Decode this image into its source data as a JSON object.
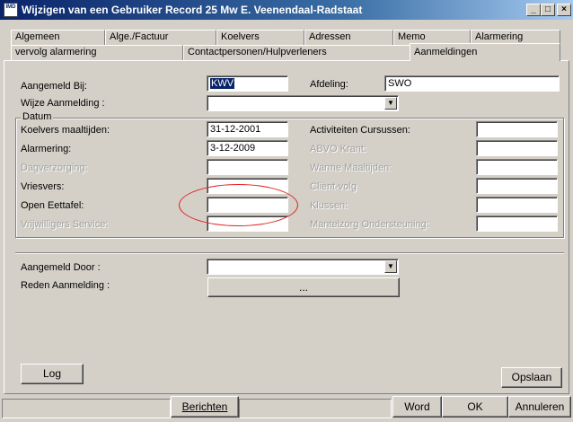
{
  "window": {
    "title": "Wijzigen van een Gebruiker Record 25 Mw E. Veenendaal-Radstaat",
    "icon_text": "IMD",
    "minimize_symbol": "_",
    "maximize_symbol": "□",
    "close_symbol": "×"
  },
  "tabs_row1": [
    "Algemeen",
    "Alge./Factuur",
    "Koelvers",
    "Adressen",
    "Memo",
    "Alarmering"
  ],
  "tabs_row2": [
    "vervolg alarmering",
    "Contactpersonen/Hulpverleners",
    "Aanmeldingen"
  ],
  "active_tab": "Aanmeldingen",
  "form": {
    "aangemeld_bij_label": "Aangemeld Bij:",
    "aangemeld_bij_value": "KWV",
    "afdeling_label": "Afdeling:",
    "afdeling_value": "SWO",
    "wijze_label": "Wijze Aanmelding :",
    "wijze_value": "",
    "datum_group_label": "Datum",
    "rows_left": [
      {
        "label": "Koelvers maaltijden:",
        "value": "31-12-2001",
        "disabled": false
      },
      {
        "label": "Alarmering:",
        "value": "3-12-2009",
        "disabled": false
      },
      {
        "label": "Dagverzorging:",
        "value": "",
        "disabled": true
      },
      {
        "label": "Vriesvers:",
        "value": "",
        "disabled": false
      },
      {
        "label": "Open Eettafel:",
        "value": "",
        "disabled": false
      },
      {
        "label": "Vrijwilligers Service:",
        "value": "",
        "disabled": true
      }
    ],
    "rows_right": [
      {
        "label": "Activiteiten Cursussen:",
        "value": "",
        "disabled": false
      },
      {
        "label": "ABVO Krant:",
        "value": "",
        "disabled": true
      },
      {
        "label": "Warme Maaltijden:",
        "value": "",
        "disabled": true
      },
      {
        "label": "Client-volg",
        "value": "",
        "disabled": true
      },
      {
        "label": "Klussen:",
        "value": "",
        "disabled": true
      },
      {
        "label": "Mantelzorg Ondersteuning:",
        "value": "",
        "disabled": true
      }
    ],
    "aangemeld_door_label": "Aangemeld Door :",
    "aangemeld_door_value": "",
    "reden_label": "Reden Aanmelding :",
    "reden_button": "...",
    "combo_arrow": "▼"
  },
  "buttons": {
    "log": "Log",
    "opslaan": "Opslaan",
    "berichten": "Berichten",
    "word": "Word",
    "ok": "OK",
    "annuleren": "Annuleren"
  },
  "colors": {
    "title_start": "#0a246a",
    "title_end": "#a6caf0",
    "face": "#d4d0c8",
    "annotation": "#e02020"
  }
}
